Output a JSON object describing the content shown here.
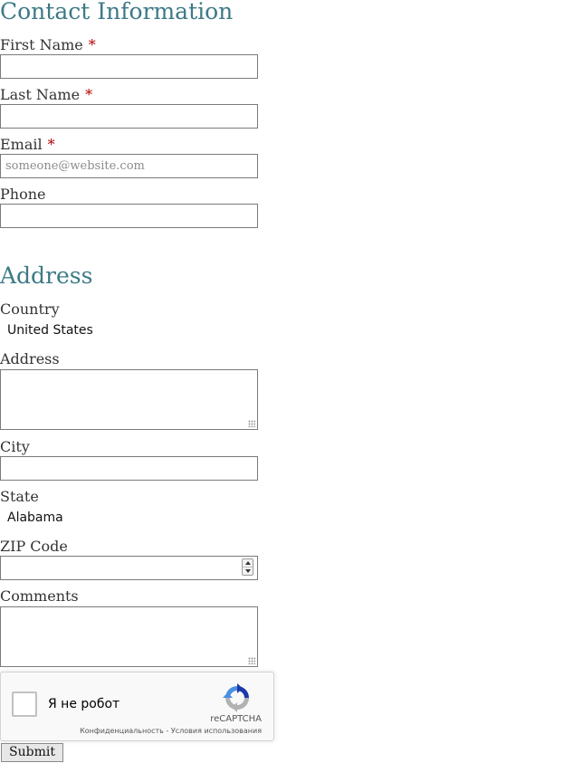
{
  "contact": {
    "heading": "Contact Information",
    "first_name": {
      "label": "First Name",
      "required": "*",
      "value": ""
    },
    "last_name": {
      "label": "Last Name",
      "required": "*",
      "value": ""
    },
    "email": {
      "label": "Email",
      "required": "*",
      "placeholder": "someone@website.com",
      "value": ""
    },
    "phone": {
      "label": "Phone",
      "value": ""
    }
  },
  "address": {
    "heading": "Address",
    "country": {
      "label": "Country",
      "selected": "United States"
    },
    "address": {
      "label": "Address",
      "value": ""
    },
    "city": {
      "label": "City",
      "value": ""
    },
    "state": {
      "label": "State",
      "selected": "Alabama"
    },
    "zip": {
      "label": "ZIP Code",
      "value": ""
    },
    "comments": {
      "label": "Comments",
      "value": ""
    }
  },
  "captcha": {
    "label": "Я не робот",
    "brand": "reCAPTCHA",
    "privacy": "Конфиденциальность",
    "separator": " - ",
    "terms": "Условия использования",
    "icon": "recaptcha-logo-icon",
    "colors": {
      "blue": "#4a90e2",
      "dark_blue": "#1c3aa9",
      "gray": "#b2b2b2"
    }
  },
  "form": {
    "submit_label": "Submit"
  },
  "colors": {
    "heading": "#3d7a86",
    "required": "#b00000",
    "text": "#333333"
  }
}
